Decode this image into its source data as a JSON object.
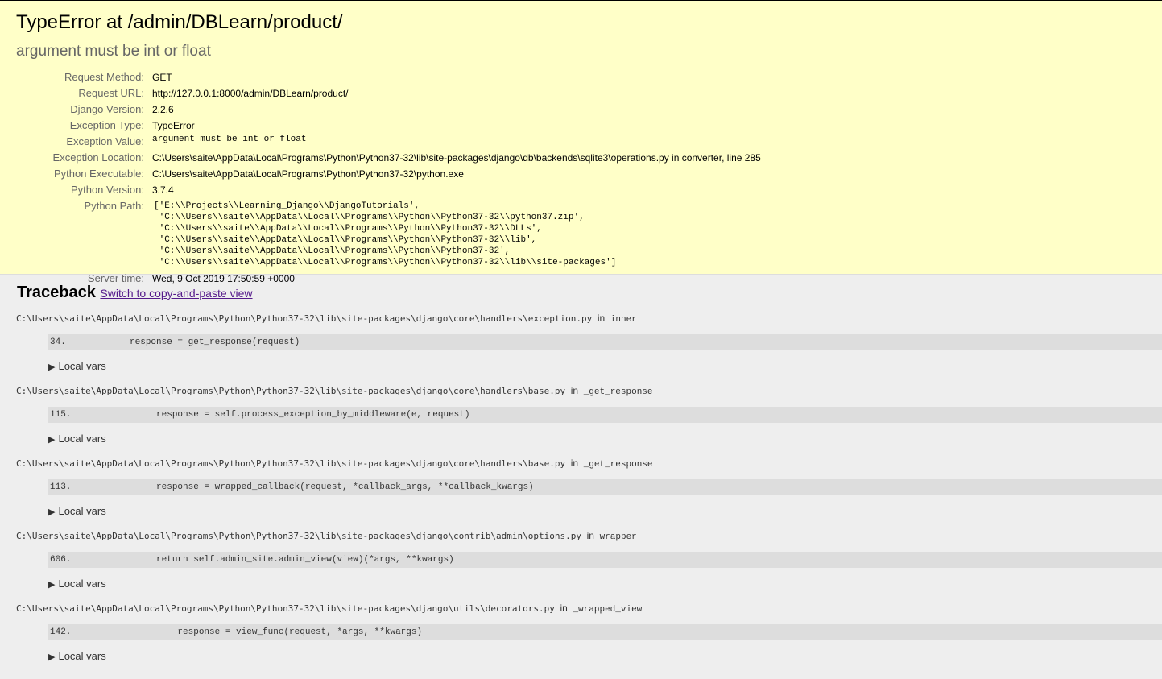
{
  "summary": {
    "title": "TypeError at /admin/DBLearn/product/",
    "subtitle": "argument must be int or float",
    "meta": {
      "request_method_label": "Request Method:",
      "request_method": "GET",
      "request_url_label": "Request URL:",
      "request_url": "http://127.0.0.1:8000/admin/DBLearn/product/",
      "django_version_label": "Django Version:",
      "django_version": "2.2.6",
      "exception_type_label": "Exception Type:",
      "exception_type": "TypeError",
      "exception_value_label": "Exception Value:",
      "exception_value": "argument must be int or float",
      "exception_location_label": "Exception Location:",
      "exception_location": "C:\\Users\\saite\\AppData\\Local\\Programs\\Python\\Python37-32\\lib\\site-packages\\django\\db\\backends\\sqlite3\\operations.py in converter, line 285",
      "python_executable_label": "Python Executable:",
      "python_executable": "C:\\Users\\saite\\AppData\\Local\\Programs\\Python\\Python37-32\\python.exe",
      "python_version_label": "Python Version:",
      "python_version": "3.7.4",
      "python_path_label": "Python Path:",
      "python_path": "['E:\\\\Projects\\\\Learning_Django\\\\DjangoTutorials',\n 'C:\\\\Users\\\\saite\\\\AppData\\\\Local\\\\Programs\\\\Python\\\\Python37-32\\\\python37.zip',\n 'C:\\\\Users\\\\saite\\\\AppData\\\\Local\\\\Programs\\\\Python\\\\Python37-32\\\\DLLs',\n 'C:\\\\Users\\\\saite\\\\AppData\\\\Local\\\\Programs\\\\Python\\\\Python37-32\\\\lib',\n 'C:\\\\Users\\\\saite\\\\AppData\\\\Local\\\\Programs\\\\Python\\\\Python37-32',\n 'C:\\\\Users\\\\saite\\\\AppData\\\\Local\\\\Programs\\\\Python\\\\Python37-32\\\\lib\\\\site-packages']",
      "server_time_label": "Server time:",
      "server_time": "Wed, 9 Oct 2019 17:50:59 +0000"
    }
  },
  "traceback": {
    "heading": "Traceback",
    "switch_link": "Switch to copy-and-paste view",
    "in_word": "in",
    "local_vars_label": "Local vars",
    "frames": [
      {
        "file": "C:\\Users\\saite\\AppData\\Local\\Programs\\Python\\Python37-32\\lib\\site-packages\\django\\core\\handlers\\exception.py",
        "function": "inner",
        "line": "34.            response = get_response(request)"
      },
      {
        "file": "C:\\Users\\saite\\AppData\\Local\\Programs\\Python\\Python37-32\\lib\\site-packages\\django\\core\\handlers\\base.py",
        "function": "_get_response",
        "line": "115.                response = self.process_exception_by_middleware(e, request)"
      },
      {
        "file": "C:\\Users\\saite\\AppData\\Local\\Programs\\Python\\Python37-32\\lib\\site-packages\\django\\core\\handlers\\base.py",
        "function": "_get_response",
        "line": "113.                response = wrapped_callback(request, *callback_args, **callback_kwargs)"
      },
      {
        "file": "C:\\Users\\saite\\AppData\\Local\\Programs\\Python\\Python37-32\\lib\\site-packages\\django\\contrib\\admin\\options.py",
        "function": "wrapper",
        "line": "606.                return self.admin_site.admin_view(view)(*args, **kwargs)"
      },
      {
        "file": "C:\\Users\\saite\\AppData\\Local\\Programs\\Python\\Python37-32\\lib\\site-packages\\django\\utils\\decorators.py",
        "function": "_wrapped_view",
        "line": "142.                    response = view_func(request, *args, **kwargs)"
      }
    ]
  }
}
